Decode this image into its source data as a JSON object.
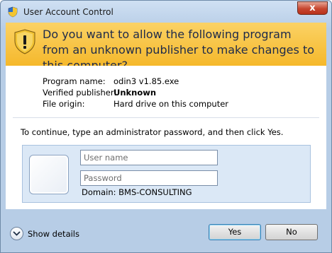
{
  "window": {
    "title": "User Account Control",
    "close_label": "x"
  },
  "banner": {
    "message": "Do you want to allow the following program from an unknown publisher to make changes to this computer?",
    "icon": "uac-shield-warning-icon"
  },
  "program_info": {
    "name_label": "Program name:",
    "name_value": "odin3 v1.85.exe",
    "publisher_label": "Verified publisher:",
    "publisher_value": "Unknown",
    "origin_label": "File origin:",
    "origin_value": "Hard drive on this computer"
  },
  "instruction": "To continue, type an administrator password, and then click Yes.",
  "credentials": {
    "username_placeholder": "User name",
    "username_value": "",
    "password_placeholder": "Password",
    "password_value": "",
    "domain": "Domain: BMS-CONSULTING"
  },
  "footer": {
    "show_details_label": "Show details",
    "yes_label": "Yes",
    "no_label": "No"
  },
  "colors": {
    "banner_accent": "#f5b82b",
    "title_bar": "#b7cde6",
    "panel_bg": "#dbe8f6"
  }
}
